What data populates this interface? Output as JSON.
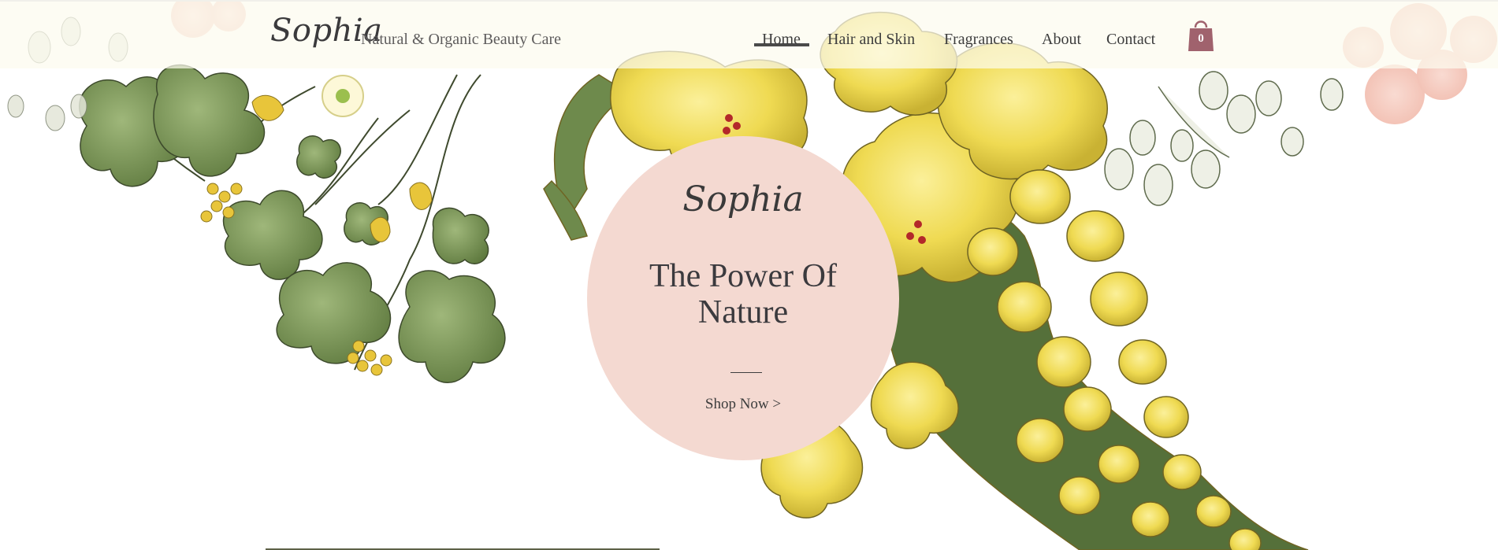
{
  "brand": {
    "logo_text": "Sophia",
    "tagline": "Natural & Organic Beauty Care"
  },
  "nav": {
    "active": "Home",
    "items": [
      {
        "label": "Home"
      },
      {
        "label": "Hair and Skin"
      },
      {
        "label": "Fragrances"
      },
      {
        "label": "About"
      },
      {
        "label": "Contact"
      }
    ]
  },
  "cart": {
    "icon": "shopping-bag-icon",
    "count": "0",
    "color": "#a0626d"
  },
  "hero": {
    "script_text": "Sophia",
    "title": "The Power Of Nature",
    "cta_label": "Shop Now >",
    "circle_color": "#f4d9d1"
  },
  "colors": {
    "accent": "#a0626d",
    "text": "#3b3a3e",
    "leaf_green": "#7c9a5a",
    "flower_yellow": "#f1df5c"
  }
}
